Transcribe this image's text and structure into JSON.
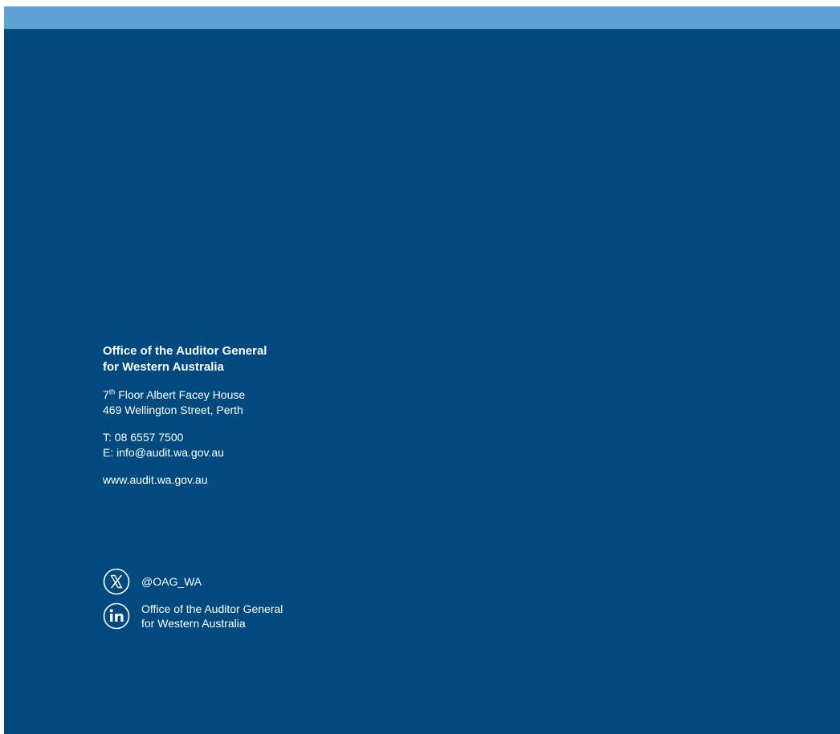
{
  "organization": {
    "name_line1": "Office of the Auditor General",
    "name_line2": "for Western Australia"
  },
  "address": {
    "floor_number": "7",
    "floor_suffix": "th",
    "line1_rest": " Floor Albert Facey House",
    "line2": "469 Wellington Street, Perth"
  },
  "contact": {
    "phone": "T: 08 6557 7500",
    "email": "E: info@audit.wa.gov.au"
  },
  "website": "www.audit.wa.gov.au",
  "social": {
    "x": {
      "icon": "x-twitter-icon",
      "handle": "@OAG_WA"
    },
    "linkedin": {
      "icon": "linkedin-icon",
      "line1": "Office of the Auditor General",
      "line2": "for Western Australia"
    }
  },
  "colors": {
    "background": "#004a80",
    "top_band": "#5fa1d2",
    "text": "#ffffff"
  }
}
